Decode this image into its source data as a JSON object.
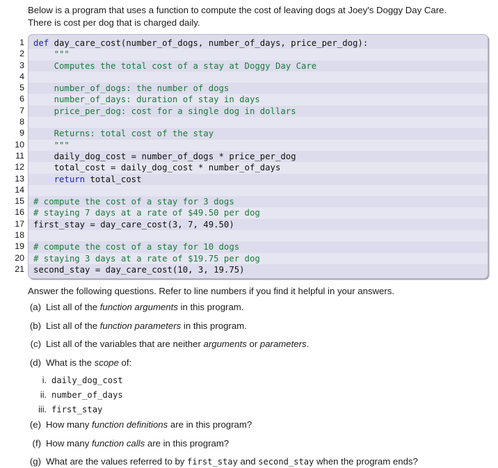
{
  "intro": {
    "line1": "Below is a program that uses a function to compute the cost of leaving dogs at Joey's Doggy Day Care.",
    "line2": "There is cost per dog that is charged daily."
  },
  "code": {
    "language": "python",
    "line_numbers": [
      "1",
      "2",
      "3",
      "4",
      "5",
      "6",
      "7",
      "8",
      "9",
      "10",
      "11",
      "12",
      "13",
      "14",
      "15",
      "16",
      "17",
      "18",
      "19",
      "20",
      "21"
    ],
    "lines": [
      {
        "n": "1",
        "segments": [
          {
            "t": "def",
            "k": "kw"
          },
          {
            "t": " day_care_cost(number_of_dogs, number_of_days, price_per_dog):",
            "k": ""
          }
        ]
      },
      {
        "n": "2",
        "segments": [
          {
            "t": "    \"\"\"",
            "k": "doc"
          }
        ]
      },
      {
        "n": "3",
        "segments": [
          {
            "t": "    Computes the total cost of a stay at Doggy Day Care",
            "k": "doc"
          }
        ]
      },
      {
        "n": "4",
        "segments": [
          {
            "t": "",
            "k": "doc"
          }
        ]
      },
      {
        "n": "5",
        "segments": [
          {
            "t": "    number_of_dogs: the number of dogs",
            "k": "doc"
          }
        ]
      },
      {
        "n": "6",
        "segments": [
          {
            "t": "    number_of_days: duration of stay in days",
            "k": "doc"
          }
        ]
      },
      {
        "n": "7",
        "segments": [
          {
            "t": "    price_per_dog: cost for a single dog in dollars",
            "k": "doc"
          }
        ]
      },
      {
        "n": "8",
        "segments": [
          {
            "t": "",
            "k": "doc"
          }
        ]
      },
      {
        "n": "9",
        "segments": [
          {
            "t": "    Returns: total cost of the stay",
            "k": "doc"
          }
        ]
      },
      {
        "n": "10",
        "segments": [
          {
            "t": "    \"\"\"",
            "k": "doc"
          }
        ]
      },
      {
        "n": "11",
        "segments": [
          {
            "t": "    daily_dog_cost = number_of_dogs * price_per_dog",
            "k": ""
          }
        ]
      },
      {
        "n": "12",
        "segments": [
          {
            "t": "    total_cost = daily_dog_cost * number_of_days",
            "k": ""
          }
        ]
      },
      {
        "n": "13",
        "segments": [
          {
            "t": "    ",
            "k": ""
          },
          {
            "t": "return",
            "k": "kw"
          },
          {
            "t": " total_cost",
            "k": ""
          }
        ]
      },
      {
        "n": "14",
        "segments": [
          {
            "t": "",
            "k": ""
          }
        ]
      },
      {
        "n": "15",
        "segments": [
          {
            "t": "# compute the cost of a stay for 3 dogs",
            "k": "cmt"
          }
        ]
      },
      {
        "n": "16",
        "segments": [
          {
            "t": "# staying 7 days at a rate of $49.50 per dog",
            "k": "cmt"
          }
        ]
      },
      {
        "n": "17",
        "segments": [
          {
            "t": "first_stay = day_care_cost(3, 7, 49.50)",
            "k": ""
          }
        ]
      },
      {
        "n": "18",
        "segments": [
          {
            "t": "",
            "k": ""
          }
        ]
      },
      {
        "n": "19",
        "segments": [
          {
            "t": "# compute the cost of a stay for 10 dogs",
            "k": "cmt"
          }
        ]
      },
      {
        "n": "20",
        "segments": [
          {
            "t": "# staying 3 days at a rate of $19.75 per dog",
            "k": "cmt"
          }
        ]
      },
      {
        "n": "21",
        "segments": [
          {
            "t": "second_stay = day_care_cost(10, 3, 19.75)",
            "k": ""
          }
        ]
      }
    ],
    "colors": {
      "background": "#dcdcec",
      "border": "#b6b6cc",
      "keyword": "#1b24c8",
      "comment": "#1d7a3c",
      "docstring": "#1d7a3c",
      "text": "#101010"
    }
  },
  "questions": {
    "lead": "Answer the following questions. Refer to line numbers if you find it helpful in your answers.",
    "items": [
      {
        "label": "(a)",
        "parts": [
          {
            "t": "List all of the ",
            "s": "plain"
          },
          {
            "t": "function arguments",
            "s": "italic"
          },
          {
            "t": " in this program.",
            "s": "plain"
          }
        ]
      },
      {
        "label": "(b)",
        "parts": [
          {
            "t": "List all of the ",
            "s": "plain"
          },
          {
            "t": "function parameters",
            "s": "italic"
          },
          {
            "t": " in this program.",
            "s": "plain"
          }
        ]
      },
      {
        "label": "(c)",
        "parts": [
          {
            "t": "List all of the variables that are neither ",
            "s": "plain"
          },
          {
            "t": "arguments",
            "s": "italic"
          },
          {
            "t": " or ",
            "s": "plain"
          },
          {
            "t": "parameters",
            "s": "italic"
          },
          {
            "t": ".",
            "s": "plain"
          }
        ]
      },
      {
        "label": "(d)",
        "parts": [
          {
            "t": "What is the ",
            "s": "plain"
          },
          {
            "t": "scope",
            "s": "italic"
          },
          {
            "t": " of:",
            "s": "plain"
          }
        ],
        "subitems": [
          {
            "label": "i.",
            "text": "daily_dog_cost"
          },
          {
            "label": "ii.",
            "text": "number_of_days"
          },
          {
            "label": "iii.",
            "text": "first_stay"
          }
        ]
      },
      {
        "label": "(e)",
        "parts": [
          {
            "t": "How many ",
            "s": "plain"
          },
          {
            "t": "function definitions",
            "s": "italic"
          },
          {
            "t": " are in this program?",
            "s": "plain"
          }
        ]
      },
      {
        "label": "(f)",
        "parts": [
          {
            "t": "How many ",
            "s": "plain"
          },
          {
            "t": "function calls",
            "s": "italic"
          },
          {
            "t": " are in this program?",
            "s": "plain"
          }
        ]
      },
      {
        "label": "(g)",
        "parts": [
          {
            "t": "What are the values referred to by ",
            "s": "plain"
          },
          {
            "t": "first_stay",
            "s": "mono"
          },
          {
            "t": " and ",
            "s": "plain"
          },
          {
            "t": "second_stay",
            "s": "mono"
          },
          {
            "t": " when the program ends?",
            "s": "plain"
          }
        ]
      }
    ]
  }
}
